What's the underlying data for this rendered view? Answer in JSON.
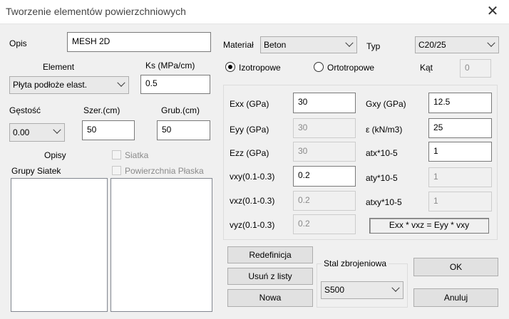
{
  "window": {
    "title": "Tworzenie elementów powierzchniowych",
    "close_glyph": "✕"
  },
  "opis": {
    "label": "Opis",
    "value": "MESH 2D"
  },
  "material": {
    "label": "Materiał",
    "value": "Beton"
  },
  "typ": {
    "label": "Typ",
    "value": "C20/25"
  },
  "element": {
    "label": "Element",
    "value": "Płyta podłoże elast."
  },
  "ks": {
    "label": "Ks (MPa/cm)",
    "value": "0.5"
  },
  "radios": {
    "izotropowe": "Izotropowe",
    "ortotropowe": "Ortotropowe",
    "selected": "izotropowe"
  },
  "kat": {
    "label": "Kąt",
    "value": "0"
  },
  "gestosc": {
    "label": "Gęstość",
    "value": "0.00"
  },
  "szer": {
    "label": "Szer.(cm)",
    "value": "50"
  },
  "grub": {
    "label": "Grub.(cm)",
    "value": "50"
  },
  "opisy": {
    "label": "Opisy"
  },
  "siatka": {
    "label": "Siatka",
    "checked": false
  },
  "grupy_siatek": {
    "label": "Grupy Siatek"
  },
  "powierzchnia_plaska": {
    "label": "Powierzchnia Płaska",
    "checked": false
  },
  "props": {
    "exx": {
      "label": "Exx (GPa)",
      "value": "30"
    },
    "eyy": {
      "label": "Eyy (GPa)",
      "value": "30"
    },
    "ezz": {
      "label": "Ezz (GPa)",
      "value": "30"
    },
    "vxy": {
      "label": "vxy(0.1-0.3)",
      "value": "0.2"
    },
    "vxz": {
      "label": "vxz(0.1-0.3)",
      "value": "0.2"
    },
    "vyz": {
      "label": "vyz(0.1-0.3)",
      "value": "0.2"
    },
    "gxy": {
      "label": "Gxy (GPa)",
      "value": "12.5"
    },
    "eps": {
      "label": "ε (kN/m3)",
      "value": "25"
    },
    "atx": {
      "label": "atx*10-5",
      "value": "1"
    },
    "aty": {
      "label": "aty*10-5",
      "value": "1"
    },
    "atxy": {
      "label": "atxy*10-5",
      "value": "1"
    },
    "formula": "Exx * vxz = Eyy * vxy"
  },
  "buttons": {
    "redefinicja": "Redefinicja",
    "usun": "Usuń z listy",
    "nowa": "Nowa",
    "ok": "OK",
    "anuluj": "Anuluj"
  },
  "stal": {
    "label": "Stal zbrojeniowa",
    "value": "S500"
  }
}
